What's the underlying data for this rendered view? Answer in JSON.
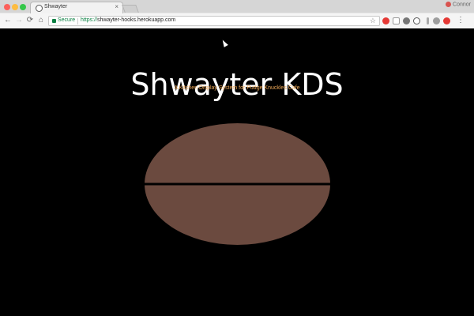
{
  "browser": {
    "tab_title": "Shwayter",
    "tab_close": "×",
    "profile_name": "Connor",
    "secure_label": "Secure",
    "url_scheme": "https://",
    "url_rest": "shwayter-hooks.herokuapp.com",
    "nav": {
      "back": "←",
      "forward": "→",
      "reload": "⟳",
      "home": "⌂"
    },
    "star": "☆",
    "menu": "⋮"
  },
  "page": {
    "title": "Shwayter KDS",
    "subtitle": "A Kitchen Display System for Pudge Knuckles Cafe"
  },
  "colors": {
    "background": "#000000",
    "title": "#ffffff",
    "subtitle": "#f0a957",
    "ellipse_fill": "#6b4a3f",
    "ellipse_line": "#000000"
  }
}
